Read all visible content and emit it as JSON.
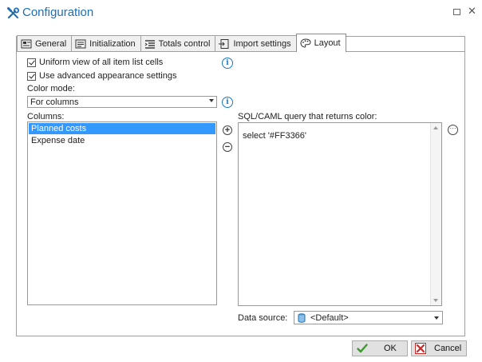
{
  "window": {
    "title": "Configuration"
  },
  "tabs": [
    {
      "label": "General",
      "icon": "general-tab-icon"
    },
    {
      "label": "Initialization",
      "icon": "initialization-tab-icon"
    },
    {
      "label": "Totals control",
      "icon": "totals-tab-icon"
    },
    {
      "label": "Import settings",
      "icon": "import-tab-icon"
    },
    {
      "label": "Layout",
      "icon": "palette-icon",
      "active": true
    }
  ],
  "layout": {
    "uniform_view_label": "Uniform view of all item list cells",
    "uniform_view_checked": true,
    "advanced_appearance_label": "Use advanced appearance settings",
    "advanced_appearance_checked": true,
    "color_mode_label": "Color mode:",
    "color_mode_value": "For columns",
    "columns_label": "Columns:",
    "columns": [
      {
        "name": "Planned costs",
        "selected": true
      },
      {
        "name": "Expense date",
        "selected": false
      }
    ],
    "query_label": "SQL/CAML query that returns color:",
    "query_value": "select '#FF3366'",
    "data_source_label": "Data source:",
    "data_source_value": "<Default>"
  },
  "buttons": {
    "ok": "OK",
    "cancel": "Cancel"
  },
  "colors": {
    "accent": "#1a6fb5",
    "selection": "#3399ff",
    "info": "#1a78c2"
  }
}
